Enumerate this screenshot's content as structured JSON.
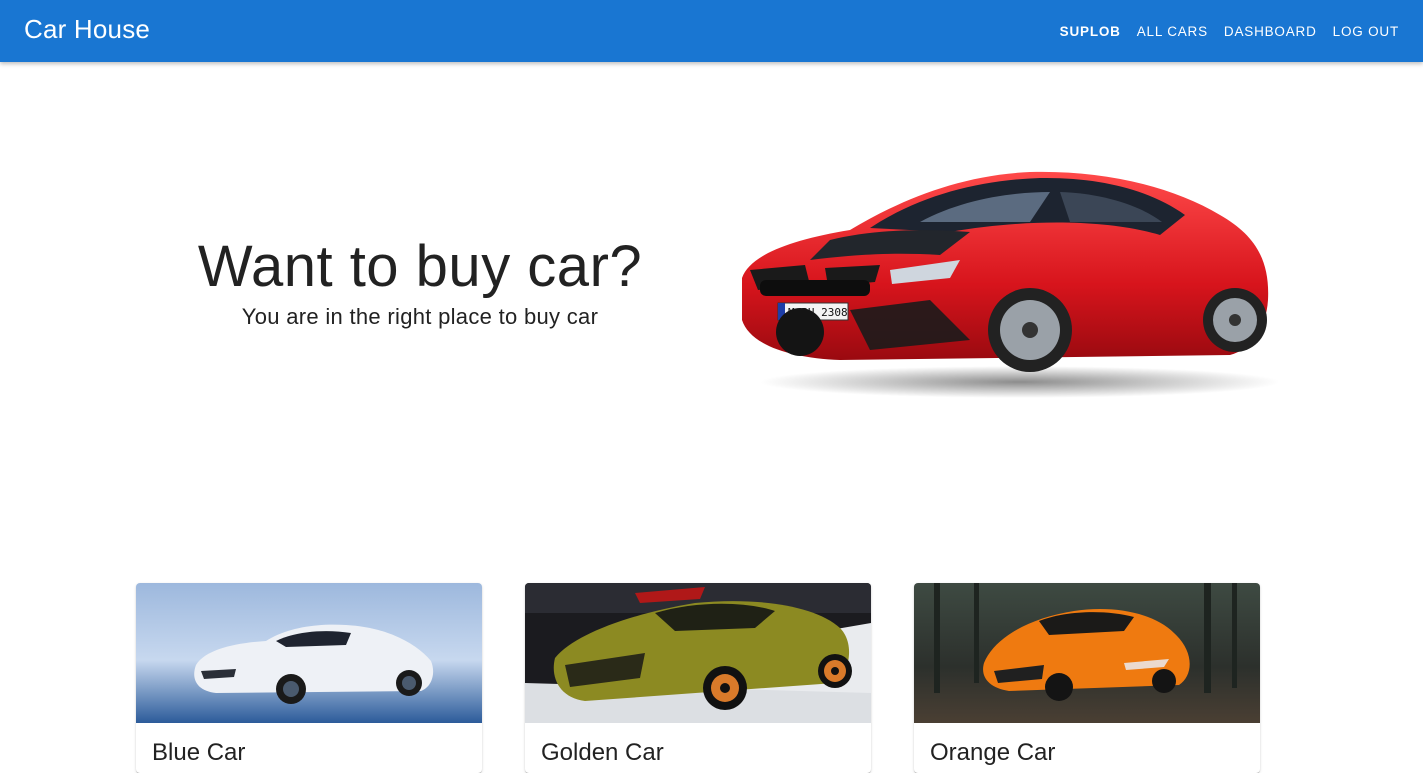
{
  "header": {
    "brand": "Car House",
    "nav": [
      {
        "label": "SUPLOB"
      },
      {
        "label": "ALL CARS"
      },
      {
        "label": "DASHBOARD"
      },
      {
        "label": "LOG OUT"
      }
    ],
    "bar_color": "#1976d2"
  },
  "hero": {
    "title": "Want to buy car?",
    "subtitle": "You are in the right place to buy car",
    "image": {
      "icon": "red-sports-car-image",
      "plate": "M PU 2308",
      "color": "#e0202a"
    }
  },
  "cars": [
    {
      "name": "Blue Car",
      "image_icon": "white-sports-car-image",
      "color": "#eef1f6"
    },
    {
      "name": "Golden Car",
      "image_icon": "gold-sports-car-image",
      "color": "#8c8a22"
    },
    {
      "name": "Orange Car",
      "image_icon": "orange-sports-car-image",
      "color": "#ef7a10"
    }
  ]
}
